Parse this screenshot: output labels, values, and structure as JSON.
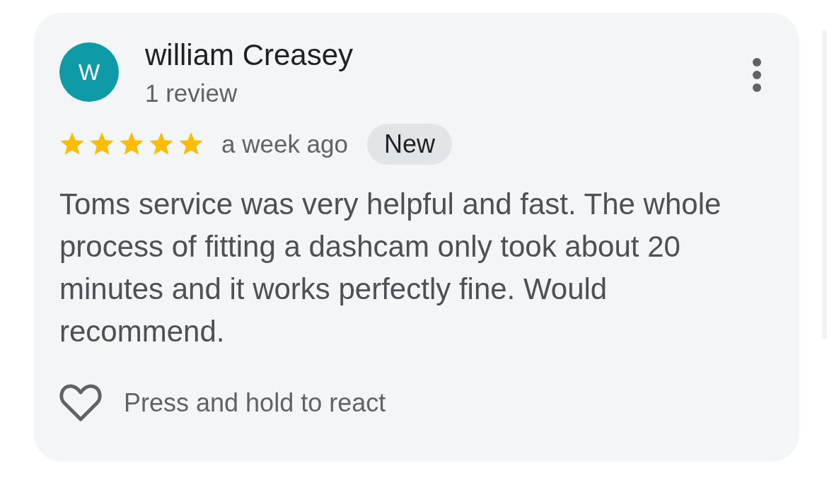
{
  "review": {
    "author": {
      "initial": "W",
      "name": "william Creasey",
      "meta": "1 review"
    },
    "stars": 5,
    "time": "a week ago",
    "badge": "New",
    "text": "Toms service was very helpful and fast. The whole process of fitting a dashcam only took about 20 minutes and it works perfectly fine. Would recommend.",
    "reaction": {
      "label": "Press and hold to react",
      "reacted": false
    }
  }
}
